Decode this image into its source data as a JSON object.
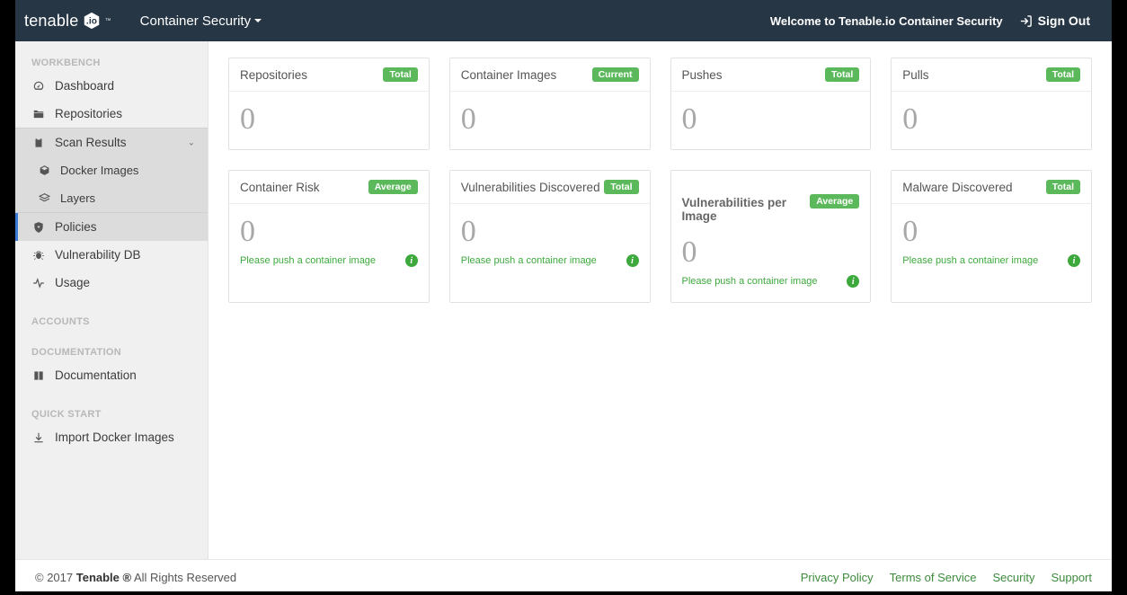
{
  "header": {
    "brand_prefix": "tenable",
    "brand_suffix": ".io",
    "tm": "™",
    "product": "Container Security",
    "welcome": "Welcome to Tenable.io Container Security",
    "signout": "Sign Out"
  },
  "sidebar": {
    "sections": {
      "workbench": "WORKBENCH",
      "accounts": "ACCOUNTS",
      "documentation": "DOCUMENTATION",
      "quickstart": "QUICK START"
    },
    "items": {
      "dashboard": "Dashboard",
      "repositories": "Repositories",
      "scan_results": "Scan Results",
      "docker_images": "Docker Images",
      "layers": "Layers",
      "policies": "Policies",
      "vuln_db": "Vulnerability DB",
      "usage": "Usage",
      "documentation": "Documentation",
      "import_docker": "Import Docker Images"
    }
  },
  "cards": {
    "repositories": {
      "title": "Repositories",
      "badge": "Total",
      "value": "0"
    },
    "container_images": {
      "title": "Container Images",
      "badge": "Current",
      "value": "0"
    },
    "pushes": {
      "title": "Pushes",
      "badge": "Total",
      "value": "0"
    },
    "pulls": {
      "title": "Pulls",
      "badge": "Total",
      "value": "0"
    },
    "container_risk": {
      "title": "Container Risk",
      "badge": "Average",
      "value": "0",
      "hint": "Please push a container image"
    },
    "vuln_discovered": {
      "title": "Vulnerabilities Discovered",
      "badge": "Total",
      "value": "0",
      "hint": "Please push a container image"
    },
    "vuln_per_image": {
      "title": "Vulnerabilities per Image",
      "badge": "Average",
      "value": "0",
      "hint": "Please push a container image"
    },
    "malware": {
      "title": "Malware Discovered",
      "badge": "Total",
      "value": "0",
      "hint": "Please push a container image"
    }
  },
  "footer": {
    "copyright_prefix": "© 2017 ",
    "copyright_brand": "Tenable ®",
    "copyright_suffix": " All Rights Reserved",
    "links": {
      "privacy": "Privacy Policy",
      "terms": "Terms of Service",
      "security": "Security",
      "support": "Support"
    }
  }
}
